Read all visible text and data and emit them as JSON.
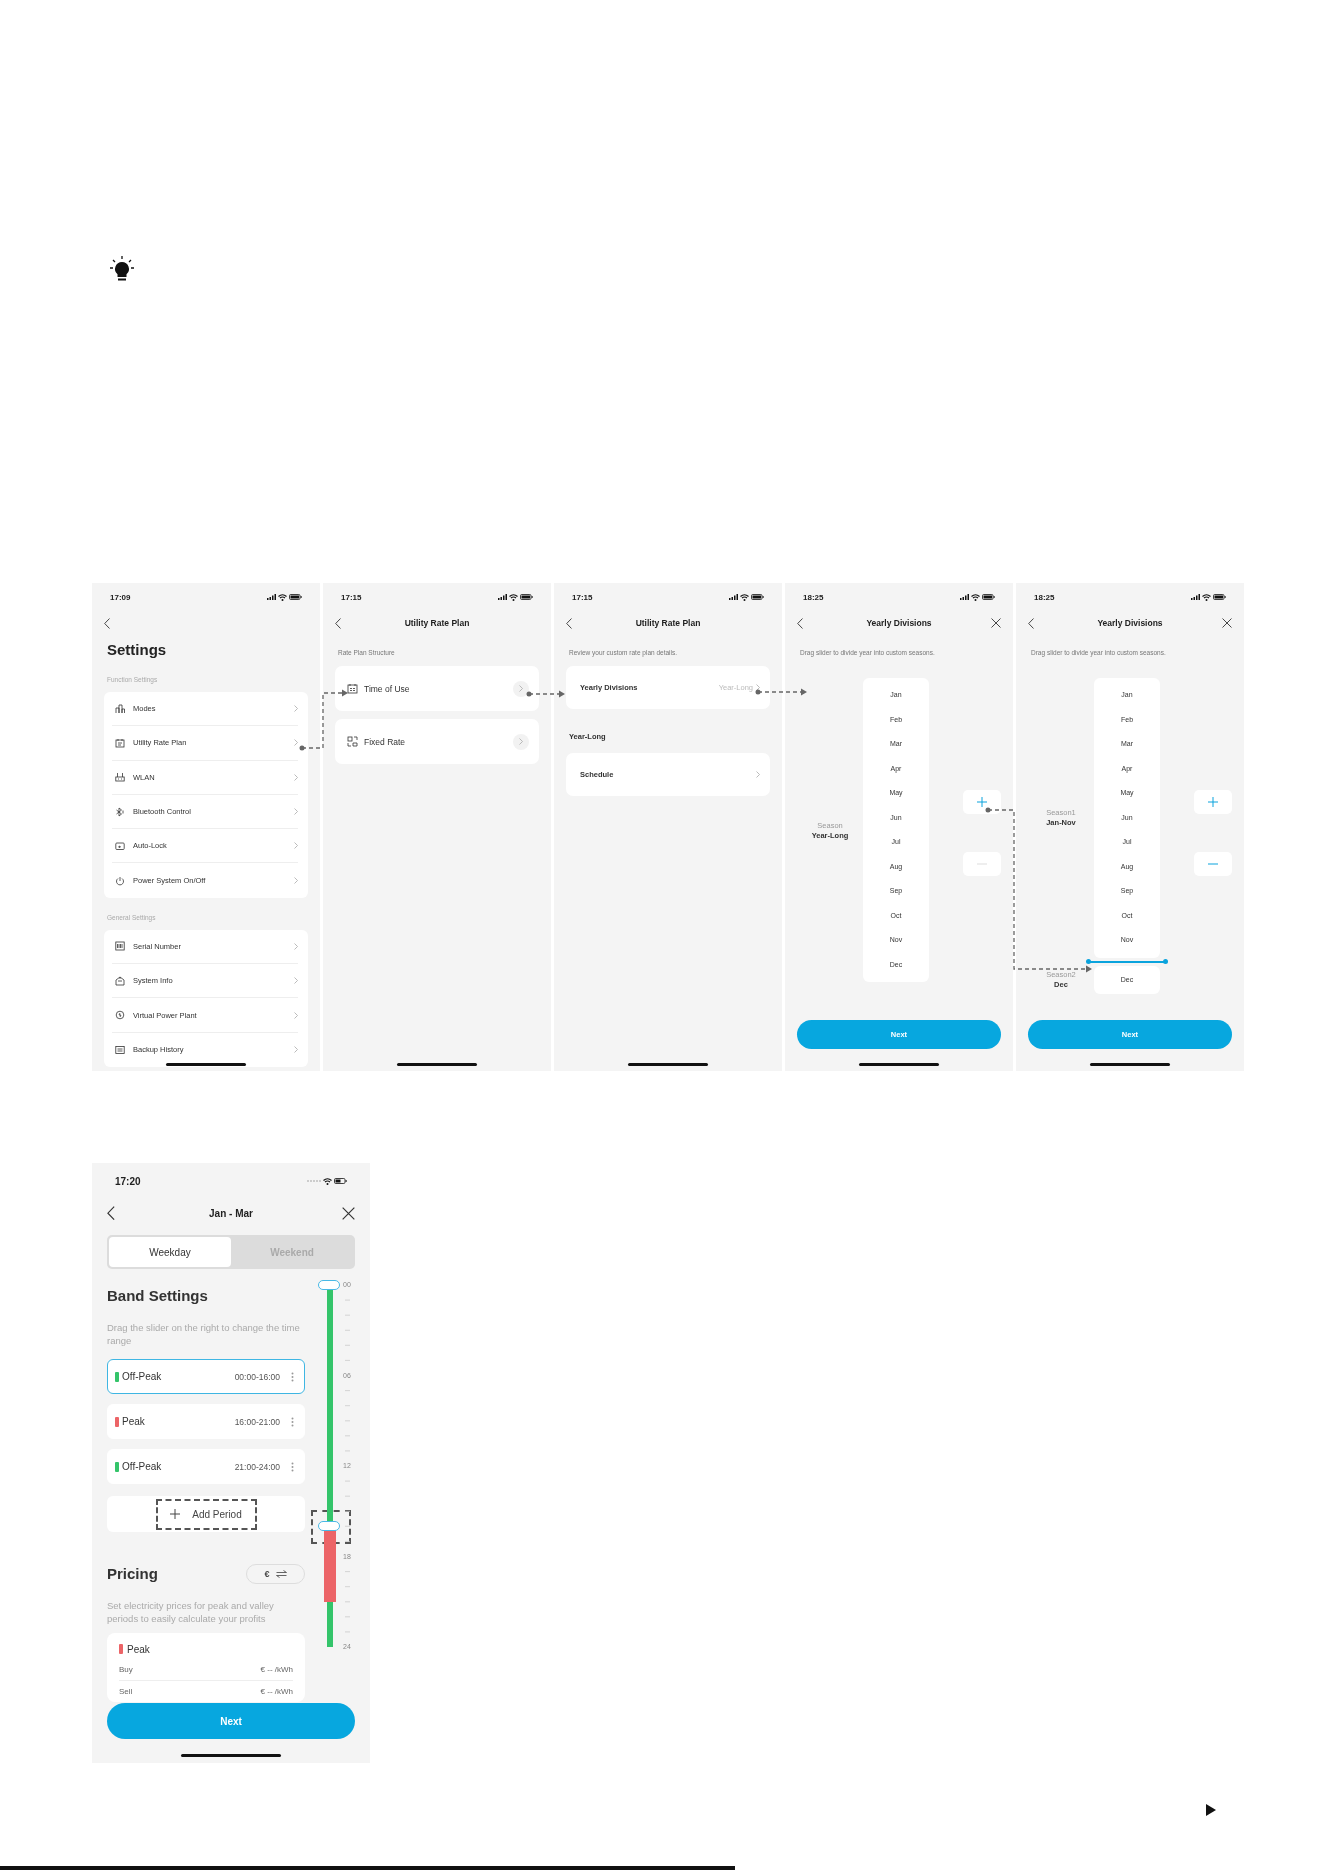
{
  "progress": {
    "level": 0.555
  },
  "screens": [
    {
      "kind": "settings",
      "time": "17:09",
      "title": "Settings",
      "sections": [
        {
          "heading": "Function Settings",
          "items": [
            "Modes",
            "Utility Rate Plan",
            "WLAN",
            "Bluetooth Control",
            "Auto-Lock",
            "Power System On/Off"
          ]
        },
        {
          "heading": "General Settings",
          "items": [
            "Serial Number",
            "System Info",
            "Virtual Power Plant",
            "Backup History"
          ]
        }
      ]
    },
    {
      "kind": "options",
      "time": "17:15",
      "title": "Utility Rate Plan",
      "subtitle": "Rate Plan Structure",
      "options": [
        "Time of Use",
        "Fixed Rate"
      ]
    },
    {
      "kind": "review",
      "time": "17:15",
      "title": "Utility Rate Plan",
      "subtitle": "Review your custom rate plan details.",
      "rows": [
        {
          "label": "Yearly Divisions",
          "value": "Year-Long"
        }
      ],
      "section": "Year-Long",
      "section_rows": [
        {
          "label": "Schedule"
        }
      ]
    },
    {
      "kind": "divisions",
      "time": "18:25",
      "title": "Yearly Divisions",
      "subtitle": "Drag slider to divide year into custom seasons.",
      "remove_disabled": true,
      "seasons": [
        {
          "label": "Season",
          "range": "Year-Long",
          "months": [
            "Jan",
            "Feb",
            "Mar",
            "Apr",
            "May",
            "Jun",
            "Jul",
            "Aug",
            "Sep",
            "Oct",
            "Nov",
            "Dec"
          ]
        }
      ],
      "button": "Next"
    },
    {
      "kind": "divisions",
      "time": "18:25",
      "title": "Yearly Divisions",
      "subtitle": "Drag slider to divide year into custom seasons.",
      "remove_disabled": false,
      "seasons": [
        {
          "label": "Season1",
          "range": "Jan-Nov",
          "months": [
            "Jan",
            "Feb",
            "Mar",
            "Apr",
            "May",
            "Jun",
            "Jul",
            "Aug",
            "Sep",
            "Oct",
            "Nov"
          ]
        },
        {
          "label": "Season2",
          "range": "Dec",
          "months": [
            "Dec"
          ]
        }
      ],
      "button": "Next"
    }
  ],
  "editor": {
    "time": "17:20",
    "title": "Jan - Mar",
    "tabs": [
      {
        "label": "Weekday",
        "selected": true
      },
      {
        "label": "Weekend",
        "selected": false
      }
    ],
    "band_title": "Band Settings",
    "band_hint": "Drag the slider on the right to change the time range",
    "bands": [
      {
        "name": "Off-Peak",
        "time": "00:00-16:00",
        "color": "#34c46a",
        "selected": true
      },
      {
        "name": "Peak",
        "time": "16:00-21:00",
        "color": "#ec6467",
        "selected": false
      },
      {
        "name": "Off-Peak",
        "time": "21:00-24:00",
        "color": "#34c46a",
        "selected": false
      }
    ],
    "add_label": "Add Period",
    "ticks": [
      "00",
      "06",
      "12",
      "18",
      "24"
    ],
    "pricing_title": "Pricing",
    "currency": "€",
    "pricing_hint": "Set electricity prices for peak and valley periods to easily calculate your profits",
    "price_card": {
      "name": "Peak",
      "color": "#ec6467",
      "rows": [
        {
          "label": "Buy",
          "value": "€ -- /kWh"
        },
        {
          "label": "Sell",
          "value": "€ -- /kWh"
        }
      ]
    },
    "button": "Next"
  }
}
